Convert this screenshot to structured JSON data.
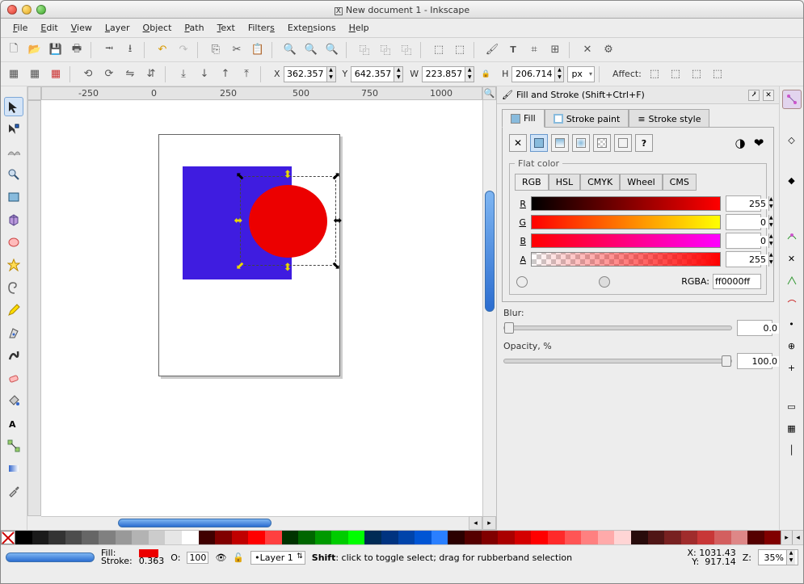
{
  "window": {
    "title": "New document 1 - Inkscape"
  },
  "menu": {
    "file": "File",
    "edit": "Edit",
    "view": "View",
    "layer": "Layer",
    "object": "Object",
    "path": "Path",
    "text": "Text",
    "filters": "Filters",
    "extensions": "Extensions",
    "help": "Help"
  },
  "tool_options": {
    "x_label": "X",
    "x": "362.357",
    "y_label": "Y",
    "y": "642.357",
    "w_label": "W",
    "w": "223.857",
    "h_label": "H",
    "h": "206.714",
    "unit": "px",
    "affect_label": "Affect:"
  },
  "ruler": {
    "m250": "-250",
    "z": "0",
    "p250": "250",
    "p500": "500",
    "p750": "750",
    "p1000": "1000"
  },
  "panel": {
    "title": "Fill and Stroke (Shift+Ctrl+F)",
    "tabs": {
      "fill": "Fill",
      "stroke_paint": "Stroke paint",
      "stroke_style": "Stroke style"
    },
    "flat_color_legend": "Flat color",
    "color_modes": {
      "rgb": "RGB",
      "hsl": "HSL",
      "cmyk": "CMYK",
      "wheel": "Wheel",
      "cms": "CMS"
    },
    "channels": {
      "r_label": "R",
      "r_val": "255",
      "g_label": "G",
      "g_val": "0",
      "b_label": "B",
      "b_val": "0",
      "a_label": "A",
      "a_val": "255"
    },
    "rgba_label": "RGBA:",
    "rgba_value": "ff0000ff",
    "blur_label": "Blur:",
    "blur_value": "0.0",
    "opacity_label": "Opacity, %",
    "opacity_value": "100.0"
  },
  "status": {
    "fill_label": "Fill:",
    "stroke_label": "Stroke:",
    "stroke_val": "0.363",
    "o_label": "O:",
    "o_val": "100",
    "layer_name": "Layer 1",
    "hint": "Shift: click to toggle select; drag for rubberband selection",
    "x_lbl": "X:",
    "x": "1031.43",
    "y_lbl": "Y:",
    "y": "917.14",
    "z_lbl": "Z:",
    "z": "35%"
  },
  "palette_colors": [
    "#000000",
    "#1a1a1a",
    "#333333",
    "#4d4d4d",
    "#666666",
    "#808080",
    "#999999",
    "#b3b3b3",
    "#cccccc",
    "#e6e6e6",
    "#ffffff",
    "#400000",
    "#800000",
    "#c00000",
    "#ff0000",
    "#ff4040",
    "#003300",
    "#006600",
    "#009900",
    "#00cc00",
    "#00ff00",
    "#002b55",
    "#003380",
    "#0044aa",
    "#0055d4",
    "#2a7fff",
    "#2b0000",
    "#550000",
    "#800000",
    "#aa0000",
    "#d40000",
    "#ff0000",
    "#ff2a2a",
    "#ff5555",
    "#ff8080",
    "#ffaaaa",
    "#ffd5d5",
    "#280b0b",
    "#501616",
    "#782121",
    "#a02c2c",
    "#c83737",
    "#d35f5f",
    "#de8787",
    "#550000",
    "#800000"
  ]
}
